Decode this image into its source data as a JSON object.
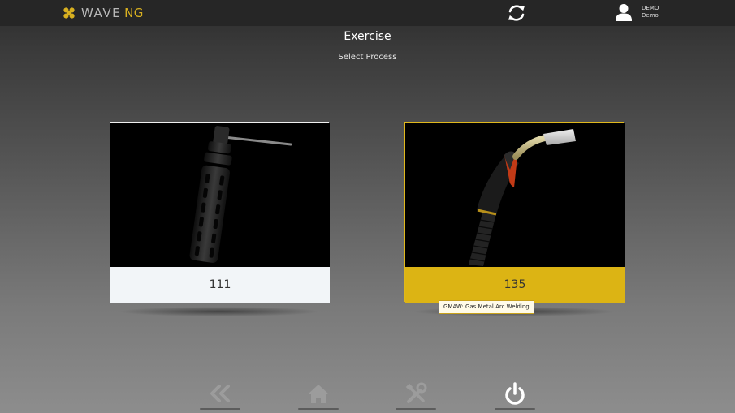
{
  "app": {
    "brand_word": "WAVE",
    "brand_accent": "NG"
  },
  "header": {
    "sync_icon": "sync-icon",
    "user": {
      "name": "DEMO",
      "role": "Demo",
      "icon": "user-icon"
    }
  },
  "page": {
    "title": "Exercise",
    "subtitle": "Select Process"
  },
  "processes": [
    {
      "code": "111",
      "image": "stick-electrode-holder",
      "selected": false
    },
    {
      "code": "135",
      "image": "mig-welding-torch",
      "selected": true,
      "tooltip": "GMAW: Gas Metal Arc Welding"
    }
  ],
  "footer": {
    "buttons": [
      "back-icon",
      "home-icon",
      "tools-icon",
      "power-icon"
    ]
  },
  "colors": {
    "accent": "#dcb414",
    "topbar": "#262626",
    "card_light": "#f2f5f8"
  }
}
